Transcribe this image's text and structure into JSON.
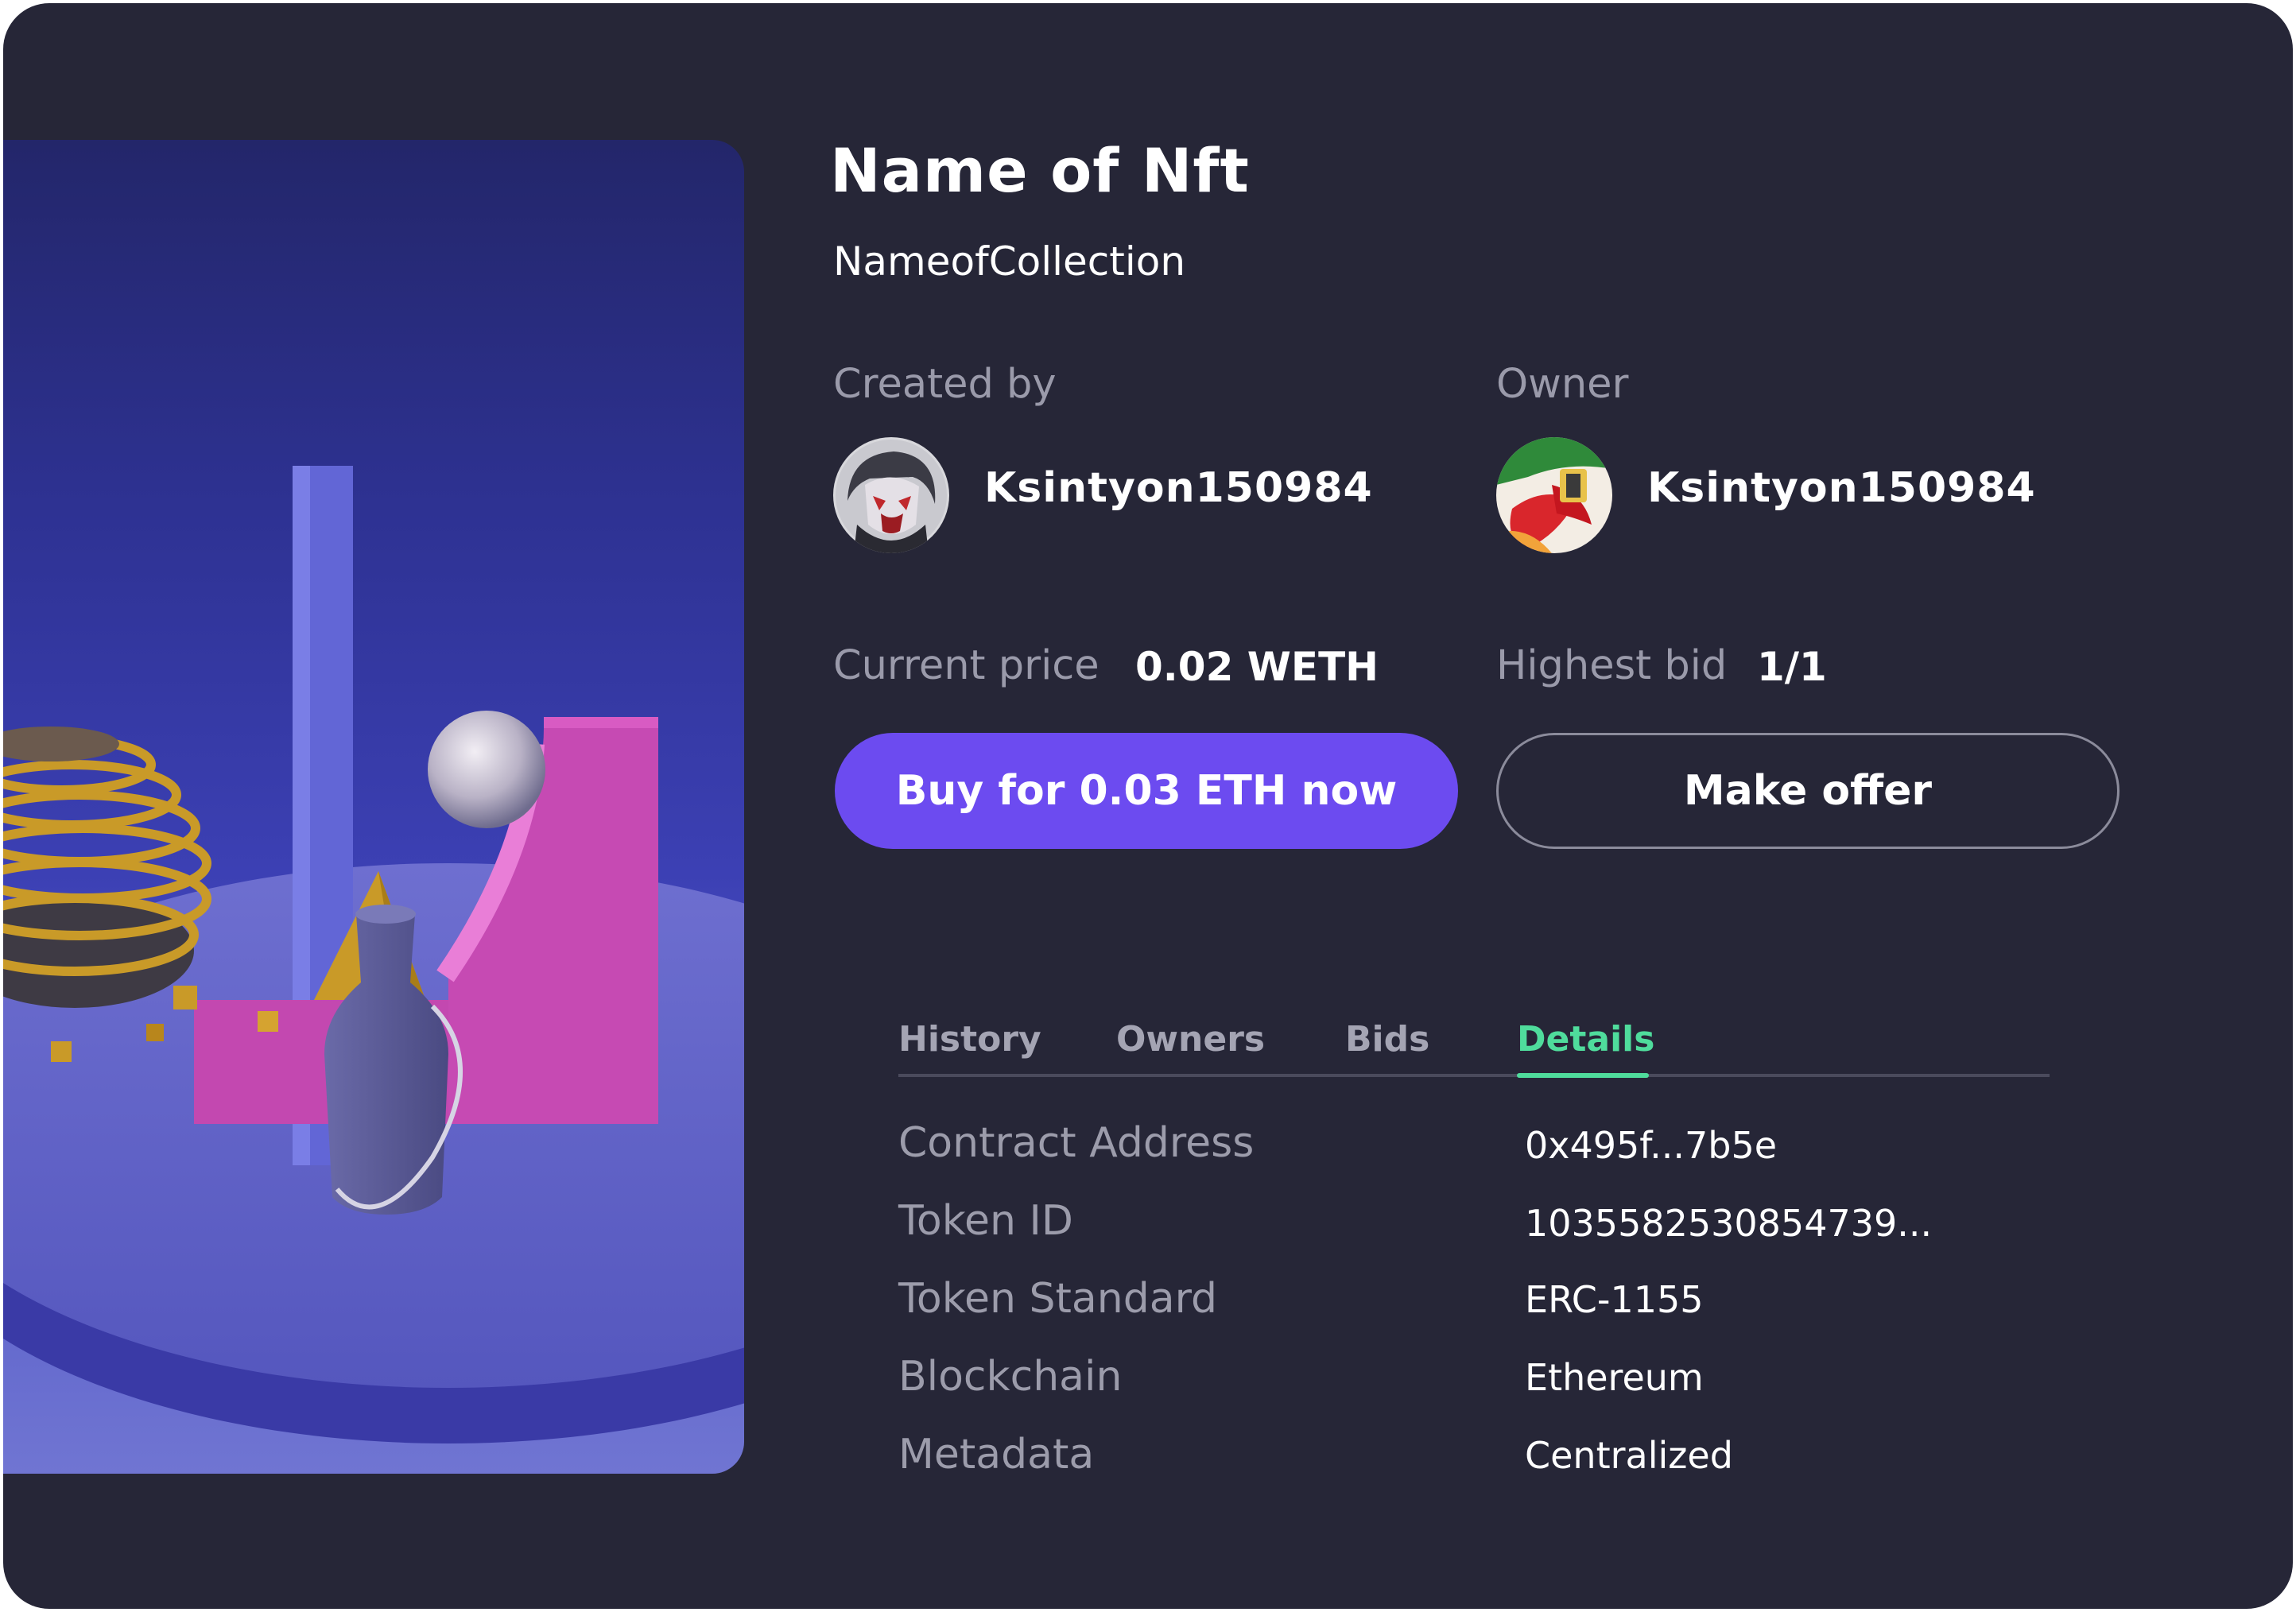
{
  "nft": {
    "title": "Name of Nft",
    "collection": "NameofCollection"
  },
  "creator": {
    "label": "Created by",
    "username": "Ksintyon150984"
  },
  "owner": {
    "label": "Owner",
    "username": "Ksintyon150984"
  },
  "pricing": {
    "current_price_label": "Current price",
    "current_price_value": "0.02 WETH",
    "highest_bid_label": "Highest bid",
    "highest_bid_value": "1/1"
  },
  "actions": {
    "buy_label": "Buy for 0.03 ETH now",
    "offer_label": "Make offer"
  },
  "tabs": [
    {
      "label": "History",
      "active": false
    },
    {
      "label": "Owners",
      "active": false
    },
    {
      "label": "Bids",
      "active": false
    },
    {
      "label": "Details",
      "active": true
    }
  ],
  "details": [
    {
      "label": "Contract Address",
      "value": "0x495f...7b5e"
    },
    {
      "label": "Token ID",
      "value": "1035582530854739..."
    },
    {
      "label": "Token Standard",
      "value": "ERC-1155"
    },
    {
      "label": "Blockchain",
      "value": "Ethereum"
    },
    {
      "label": "Metadata",
      "value": "Centralized"
    }
  ],
  "colors": {
    "card_background": "#262637",
    "accent_purple": "#6c4bf0",
    "active_tab_green": "#4fdc9c",
    "muted_text": "#9a9aaa"
  },
  "icons": {
    "creator_avatar": "creator-avatar-image",
    "owner_avatar": "owner-avatar-image"
  }
}
